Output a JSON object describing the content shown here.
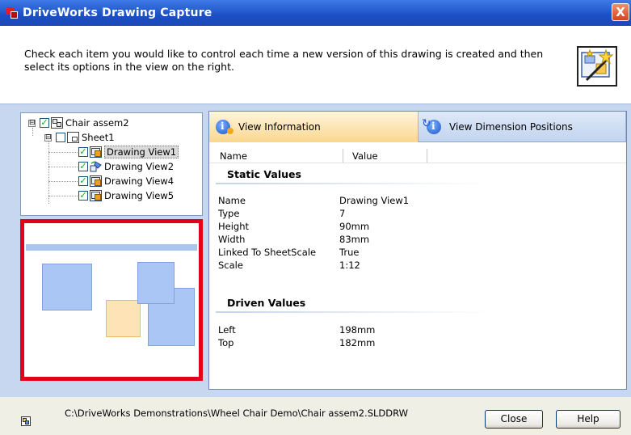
{
  "window": {
    "title": "DriveWorks Drawing Capture",
    "close_glyph": "X"
  },
  "instructions": {
    "text": "Check each item you would like to control each time a new version of this drawing is created and then select its options in the view on the right."
  },
  "tree": {
    "root": {
      "label": "Chair assem2",
      "expander": "⊟",
      "checked": "✓"
    },
    "sheet": {
      "label": "Sheet1",
      "expander": "⊟"
    },
    "views": [
      {
        "label": "Drawing View1",
        "checked": "✓"
      },
      {
        "label": "Drawing View2",
        "checked": "✓"
      },
      {
        "label": "Drawing View4",
        "checked": "✓"
      },
      {
        "label": "Drawing View5",
        "checked": "✓"
      }
    ]
  },
  "tabs": {
    "info": "View Information",
    "dimensions": "View Dimension Positions"
  },
  "columns": {
    "name": "Name",
    "value": "Value"
  },
  "static_values": {
    "title": "Static Values",
    "rows": [
      {
        "name": "Name",
        "value": "Drawing View1"
      },
      {
        "name": "Type",
        "value": "7"
      },
      {
        "name": "Height",
        "value": "90mm"
      },
      {
        "name": "Width",
        "value": "83mm"
      },
      {
        "name": "Linked To SheetScale",
        "value": "True"
      },
      {
        "name": "Scale",
        "value": "1:12"
      }
    ]
  },
  "driven_values": {
    "title": "Driven Values",
    "rows": [
      {
        "name": "Left",
        "value": "198mm"
      },
      {
        "name": "Top",
        "value": "182mm"
      }
    ]
  },
  "footer": {
    "path": "C:\\DriveWorks Demonstrations\\Wheel Chair Demo\\Chair assem2.SLDDRW",
    "close_label": "Close",
    "help_label": "Help"
  },
  "colors": {
    "titlebar": "#1b4fc4",
    "highlight_border": "#e3001b",
    "panel_band": "#c6d7ef",
    "active_tab": "#fbd78e"
  }
}
